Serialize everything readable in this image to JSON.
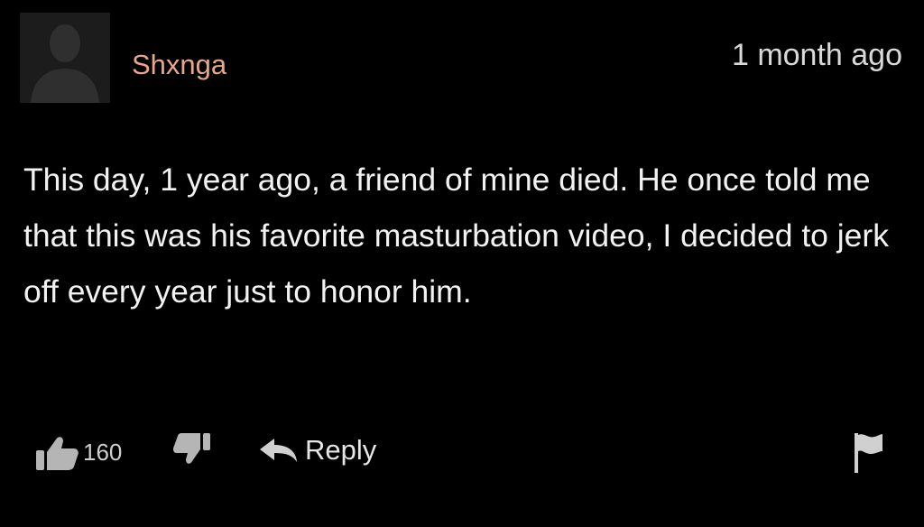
{
  "comment": {
    "author": "Shxnga",
    "timestamp": "1 month ago",
    "body": "This day, 1 year ago, a friend of mine died. He once told me that this was his favorite masturbation video, I decided to jerk off every year just to honor him.",
    "likes": "160",
    "reply_label": "Reply"
  },
  "icons": {
    "avatar": "default-avatar-silhouette",
    "like": "thumbs-up-icon",
    "dislike": "thumbs-down-icon",
    "reply": "reply-arrow-icon",
    "flag": "flag-icon"
  },
  "colors": {
    "background": "#000000",
    "username": "#e6a889",
    "text": "#f2f2f2",
    "muted": "#cfcfcf",
    "icon": "#b5b5b5"
  }
}
